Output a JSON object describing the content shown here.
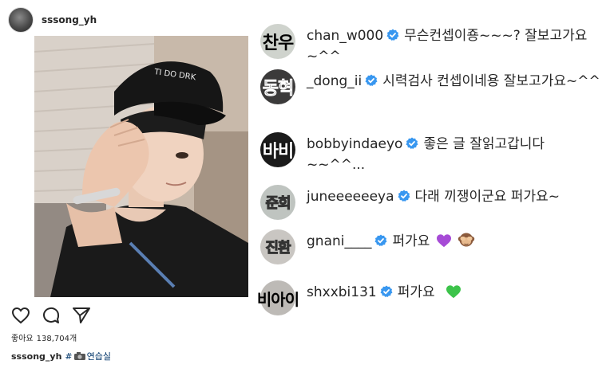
{
  "post": {
    "username": "sssong_yh",
    "likes_label": "좋아요",
    "likes_count": "138,704개",
    "caption_user": "sssong_yh",
    "caption_hash": "#",
    "caption_tag": "연습실",
    "cap_text": "TI DO DRK"
  },
  "icons": {
    "like": "heart-icon",
    "comment": "comment-icon",
    "share": "paper-plane-icon",
    "camera": "camera-emoji-icon",
    "verified": "verified-badge-icon"
  },
  "colors": {
    "verified_blue": "#3897f0",
    "text": "#262626",
    "link": "#003569",
    "purple_heart": "#a64bd6",
    "green_heart": "#3cc34a"
  },
  "comments": [
    {
      "avatar_text": "찬우",
      "user": "chan_w000",
      "text": "무슨컨셉이죵~~~? 잘보고가요 ~^^"
    },
    {
      "avatar_text": "동혁",
      "user": "_dong_ii",
      "text": "시력검사 컨셉이네용 잘보고가요~^^"
    },
    {
      "avatar_text": "바비",
      "user": "bobbyindaeyo",
      "text": "좋은 글 잘읽고갑니다 ~~^^..."
    },
    {
      "avatar_text": "준회",
      "user": "juneeeeeeya",
      "text": "다래 끼쟁이군요 퍼가요~"
    },
    {
      "avatar_text": "진환",
      "user": "gnani____",
      "text": "퍼가요"
    },
    {
      "avatar_text": "비아이",
      "user": "shxxbi131",
      "text": "퍼가요"
    }
  ]
}
